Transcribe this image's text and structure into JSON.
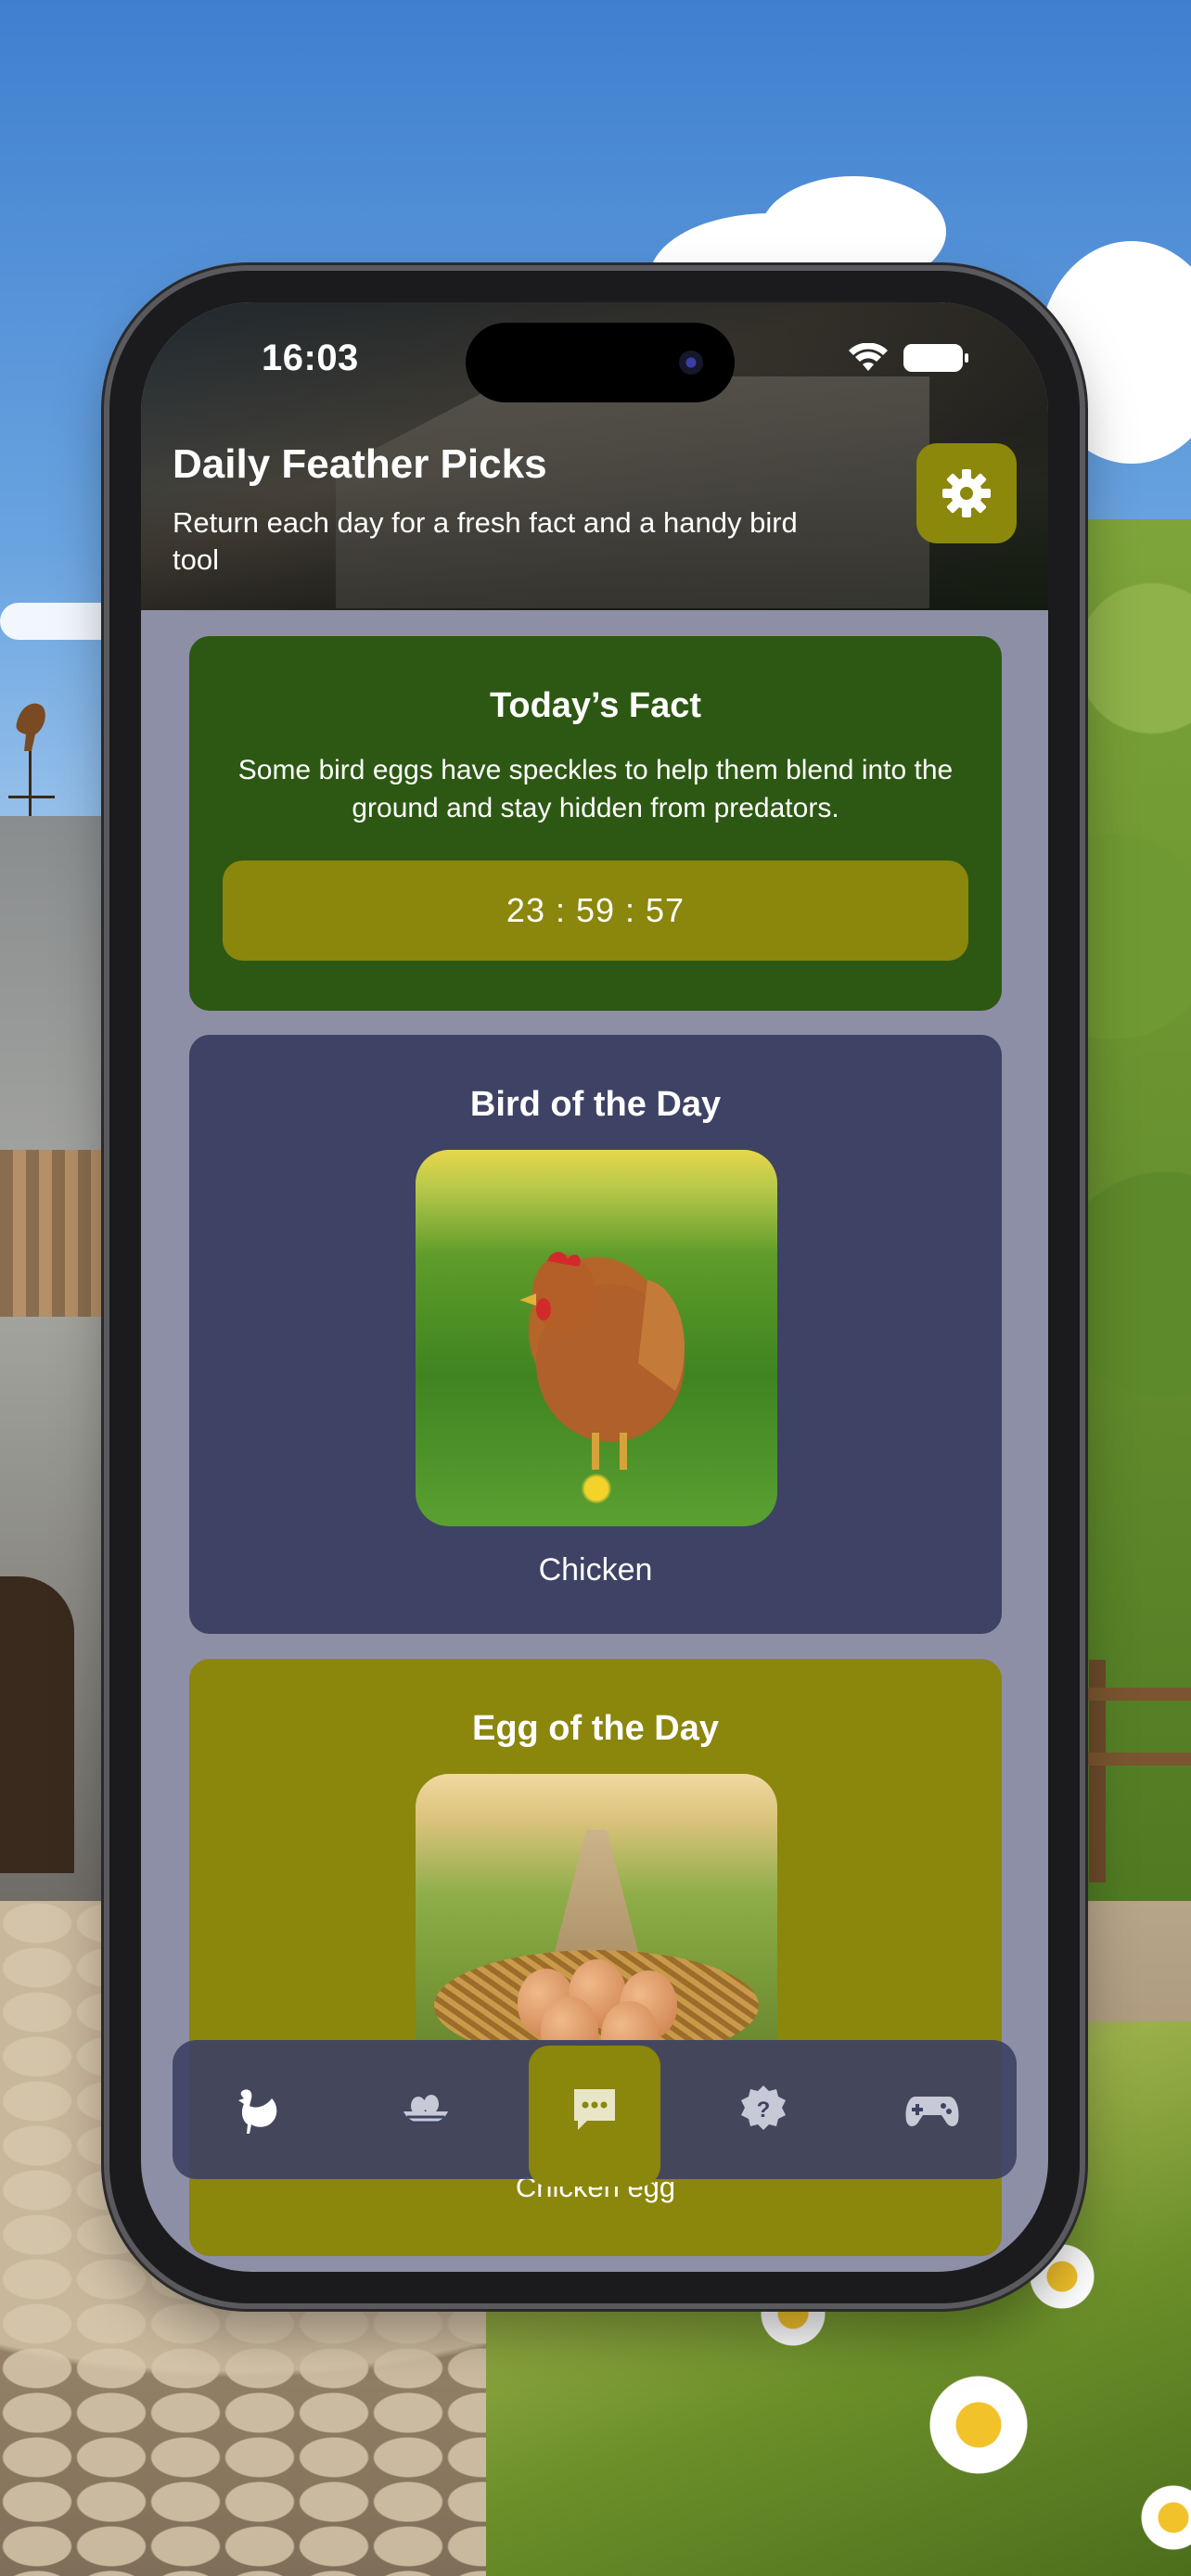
{
  "status_bar": {
    "time": "16:03"
  },
  "header": {
    "title": "Daily Feather Picks",
    "subtitle": "Return each day for a fresh fact and a handy bird tool",
    "settings_icon": "gear-icon"
  },
  "fact_card": {
    "title": "Today’s Fact",
    "text": "Some bird eggs have speckles to help them blend into the ground and stay hidden from predators.",
    "countdown": "23 : 59 : 57"
  },
  "bird_card": {
    "title": "Bird of the Day",
    "name": "Chicken"
  },
  "egg_card": {
    "title": "Egg of the Day",
    "name": "Chicken egg"
  },
  "tabbar": {
    "items": [
      {
        "icon": "chicken-icon",
        "active": false
      },
      {
        "icon": "nest-icon",
        "active": false
      },
      {
        "icon": "chat-bubble-icon",
        "active": true
      },
      {
        "icon": "question-icon",
        "active": false
      },
      {
        "icon": "gamepad-icon",
        "active": false
      }
    ]
  },
  "colors": {
    "accent_olive": "#8b860c",
    "fact_green": "#2d5813",
    "bird_navy": "#3e4264",
    "screen_bg": "#8d8fa6"
  }
}
